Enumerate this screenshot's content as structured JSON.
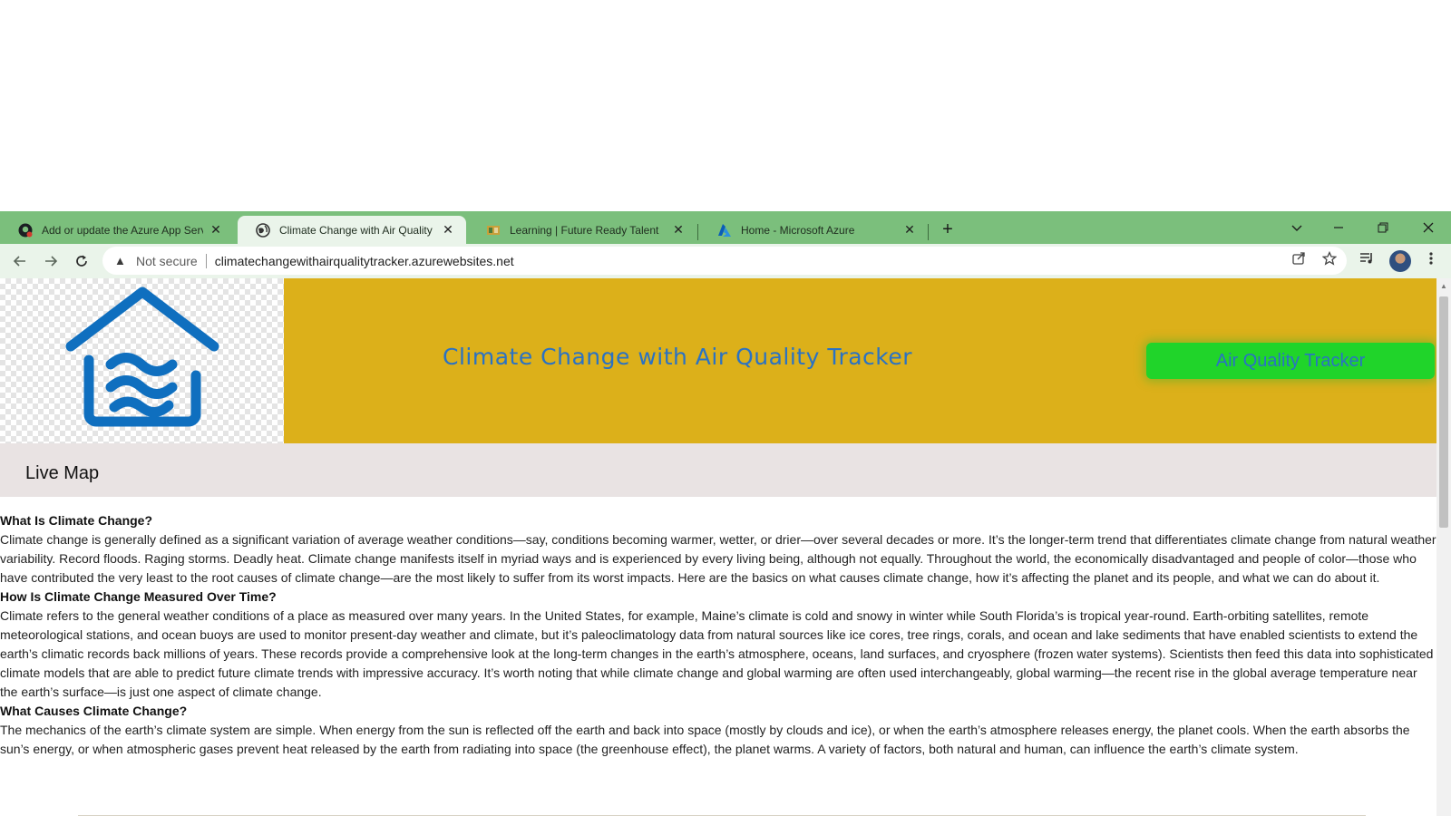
{
  "browser": {
    "tabs": [
      {
        "title": "Add or update the Azure App Servic",
        "icon": "github-icon"
      },
      {
        "title": "Climate Change with Air Quality Tra",
        "icon": "globe-icon",
        "active": true
      },
      {
        "title": "Learning | Future Ready Talent",
        "icon": "learning-icon"
      },
      {
        "title": "Home - Microsoft Azure",
        "icon": "azure-icon"
      }
    ],
    "security_label": "Not secure",
    "url": "climatechangewithairqualitytracker.azurewebsites.net"
  },
  "page": {
    "header_title": "Climate Change with Air Quality Tracker",
    "header_button": "Air Quality Tracker",
    "nav_link": "Live Map",
    "logo_color": "#0f6fbf",
    "header_bg": "#dcb01a",
    "button_bg": "#20d42a",
    "sections": [
      {
        "heading": "What Is Climate Change?",
        "body": "Climate change is generally defined as a significant variation of average weather conditions—say, conditions becoming warmer, wetter, or drier—over several decades or more. It’s the longer-term trend that differentiates climate change from natural weather variability. Record floods. Raging storms. Deadly heat. Climate change manifests itself in myriad ways and is experienced by every living being, although not equally. Throughout the world, the economically disadvantaged and people of color—those who have contributed the very least to the root causes of climate change—are the most likely to suffer from its worst impacts. Here are the basics on what causes climate change, how it’s affecting the planet and its people, and what we can do about it."
      },
      {
        "heading": "How Is Climate Change Measured Over Time?",
        "body": "Climate refers to the general weather conditions of a place as measured over many years. In the United States, for example, Maine’s climate is cold and snowy in winter while South Florida’s is tropical year-round. Earth-orbiting satellites, remote meteorological stations, and ocean buoys are used to monitor present-day weather and climate, but it’s paleoclimatology data from natural sources like ice cores, tree rings, corals, and ocean and lake sediments that have enabled scientists to extend the earth’s climatic records back millions of years. These records provide a comprehensive look at the long-term changes in the earth’s atmosphere, oceans, land surfaces, and cryosphere (frozen water systems). Scientists then feed this data into sophisticated climate models that are able to predict future climate trends with impressive accuracy. It’s worth noting that while climate change and global warming are often used interchangeably, global warming—the recent rise in the global average temperature near the earth’s surface—is just one aspect of climate change."
      },
      {
        "heading": "What Causes Climate Change?",
        "body": "The mechanics of the earth’s climate system are simple. When energy from the sun is reflected off the earth and back into space (mostly by clouds and ice), or when the earth’s atmosphere releases energy, the planet cools. When the earth absorbs the sun’s energy, or when atmospheric gases prevent heat released by the earth from radiating into space (the greenhouse effect), the planet warms. A variety of factors, both natural and human, can influence the earth’s climate system."
      }
    ]
  }
}
